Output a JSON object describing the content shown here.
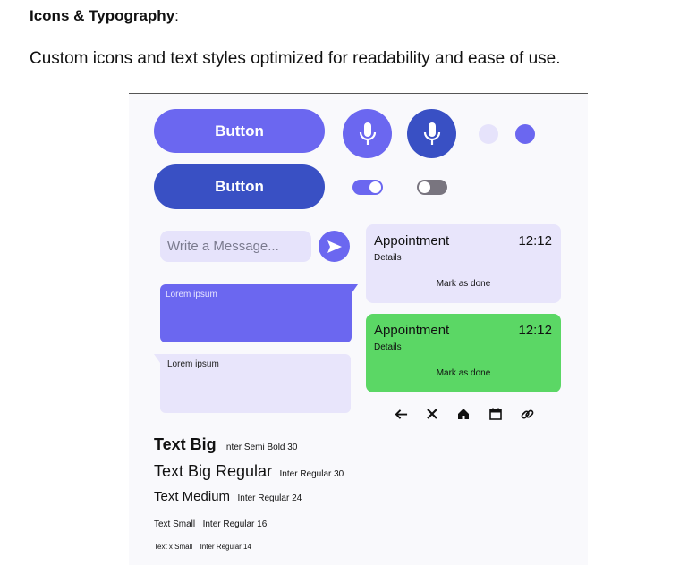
{
  "header": {
    "title": "Icons & Typography",
    "title_suffix": ":",
    "description": "Custom icons and text styles optimized for readability and ease of use."
  },
  "colors": {
    "primary_light": "#6b67f0",
    "primary_dark": "#3950c4",
    "surface_light": "#e6e3fb",
    "success": "#5bd765",
    "toggle_off": "#79757f"
  },
  "buttons": {
    "primary_light_label": "Button",
    "primary_dark_label": "Button"
  },
  "icons": {
    "mic_light": "microphone-icon",
    "mic_dark": "microphone-icon",
    "send": "send-icon",
    "nav": [
      "arrow-left-icon",
      "close-icon",
      "home-icon",
      "calendar-icon",
      "link-icon"
    ]
  },
  "controls": {
    "radio_unselected": false,
    "radio_selected": true,
    "toggle_on": true,
    "toggle_off": false
  },
  "chat": {
    "input_placeholder": "Write a Message...",
    "sent_message": "Lorem ipsum",
    "received_message": "Lorem ipsum"
  },
  "cards": [
    {
      "title": "Appointment",
      "time": "12:12",
      "details": "Details",
      "action": "Mark as done"
    },
    {
      "title": "Appointment",
      "time": "12:12",
      "details": "Details",
      "action": "Mark as done"
    }
  ],
  "typography": [
    {
      "sample": "Text Big",
      "spec": "Inter Semi Bold 30"
    },
    {
      "sample": "Text Big Regular",
      "spec": "Inter Regular 30"
    },
    {
      "sample": "Text Medium",
      "spec": "Inter Regular 24"
    },
    {
      "sample": "Text Small",
      "spec": "Inter Regular 16"
    },
    {
      "sample": "Text x Small",
      "spec": "Inter Regular 14"
    }
  ]
}
